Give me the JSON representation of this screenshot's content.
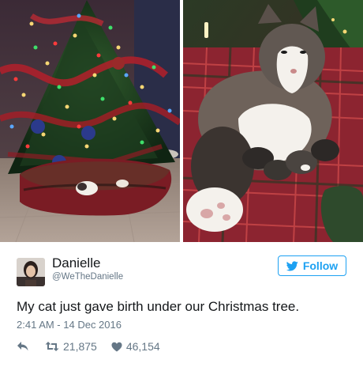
{
  "photos": {
    "left_icon": "christmas-tree-photo",
    "right_icon": "cat-with-kittens-photo"
  },
  "tweet": {
    "display_name": "Danielle",
    "handle": "@WeTheDanielle",
    "follow_label": "Follow",
    "text": "My cat just gave birth under our Christmas tree.",
    "timestamp": "2:41 AM - 14 Dec 2016",
    "retweets": "21,875",
    "likes": "46,154"
  },
  "icons": {
    "follow": "twitter-bird-icon",
    "reply": "reply-icon",
    "retweet": "retweet-icon",
    "like": "heart-icon"
  },
  "colors": {
    "accent": "#1da1f2",
    "muted": "#657786",
    "text": "#14171a"
  }
}
